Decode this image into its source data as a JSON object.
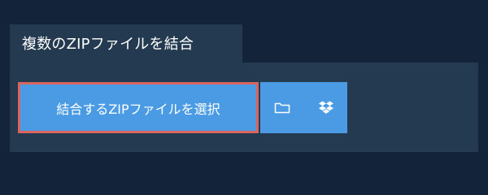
{
  "header": {
    "tab_title": "複数のZIPファイルを結合"
  },
  "panel": {
    "select_label": "結合するZIPファイルを選択",
    "icons": [
      "folder-icon",
      "dropbox-icon"
    ]
  },
  "colors": {
    "background": "#12233a",
    "panel": "#233a51",
    "button": "#4b9be4",
    "highlight_border": "#d9655e",
    "text": "#ffffff"
  }
}
